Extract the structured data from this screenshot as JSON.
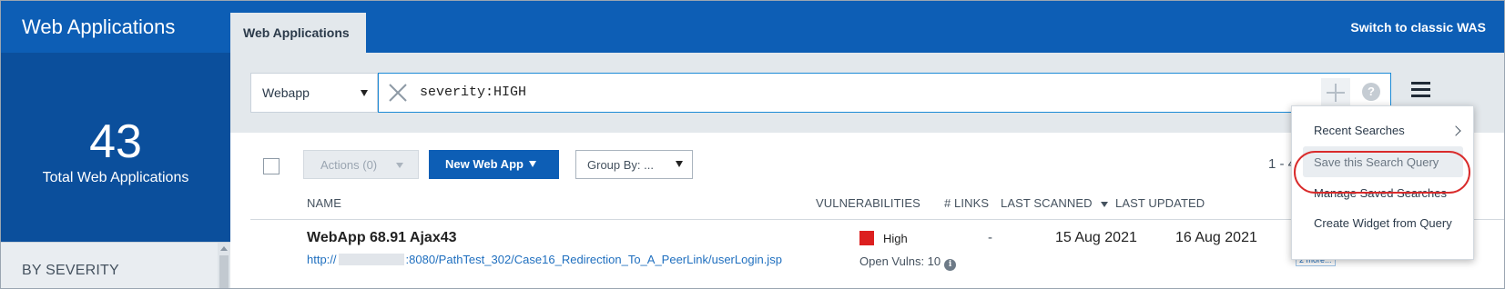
{
  "header": {
    "app_title": "Web Applications",
    "active_tab": "Web Applications",
    "switch_link": "Switch to classic WAS"
  },
  "sidebar": {
    "total_count": "43",
    "total_label": "Total Web Applications",
    "severity_heading": "BY SEVERITY"
  },
  "search": {
    "type_value": "Webapp",
    "query": "severity:HIGH",
    "help_glyph": "?"
  },
  "toolbar": {
    "actions_label": "Actions (0)",
    "new_label": "New Web App",
    "group_label": "Group By: ...",
    "pagination": "1 - 4"
  },
  "table": {
    "columns": [
      "NAME",
      "VULNERABILITIES",
      "# LINKS",
      "LAST SCANNED",
      "LAST UPDATED"
    ],
    "rows": [
      {
        "name": "WebApp 68.91 Ajax43",
        "url_prefix": "http://",
        "url_suffix": ":8080/PathTest_302/Case16_Redirection_To_A_PeerLink/userLogin.jsp",
        "severity": "High",
        "open_vulns": "Open Vulns: 10",
        "links": "-",
        "last_scanned": "15 Aug 2021",
        "last_updated": "16 Aug 2021",
        "tags_more": "2 more..."
      }
    ]
  },
  "menu": {
    "items": [
      "Recent Searches",
      "Save this Search Query",
      "Manage Saved Searches",
      "Create Widget from Query"
    ]
  },
  "colors": {
    "brand_blue": "#0d5eb5",
    "sidebar_blue": "#0b4f9c",
    "severity_high": "#dc1f1f",
    "highlight_ring": "#d92b2b"
  },
  "icons": [
    "clear-icon",
    "plus-icon",
    "help-icon",
    "hamburger-menu-icon",
    "chevron-right-icon",
    "chevron-down-icon",
    "info-icon"
  ]
}
